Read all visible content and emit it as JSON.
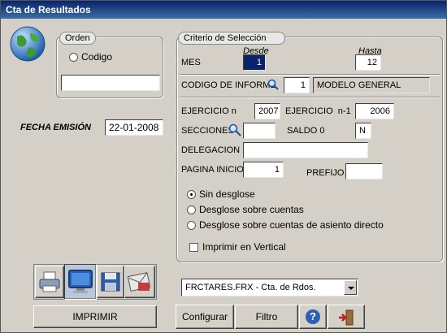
{
  "window": {
    "title": "Cta de Resultados"
  },
  "orden": {
    "legend": "Orden",
    "radio_label": "Codigo",
    "search_value": ""
  },
  "fecha_emision": {
    "label": "FECHA EMISIÓN",
    "value": "22-01-2008"
  },
  "criterio": {
    "legend": "Criterio de Selección",
    "desde_label": "Desde",
    "hasta_label": "Hasta",
    "mes_label": "MES",
    "mes_desde": "1",
    "mes_hasta": "12",
    "codigo_informe_label": "CODIGO DE INFORME",
    "codigo_informe_value": "1",
    "codigo_informe_desc": "MODELO GENERAL",
    "ejercicio_n_label": "EJERCICIO n",
    "ejercicio_n_value": "2007",
    "ejercicio_n1_label": "EJERCICIO  n-1",
    "ejercicio_n1_value": "2006",
    "secciones_label": "SECCIONES",
    "secciones_value": "",
    "saldo0_label": "SALDO 0",
    "saldo0_value": "N",
    "delegacion_label": "DELEGACION",
    "delegacion_value": "",
    "pagina_inicio_label": "PAGINA INICIO",
    "pagina_inicio_value": "1",
    "prefijo_label": "PREFIJO",
    "prefijo_value": "",
    "options": [
      {
        "label": "Sin desglose",
        "selected": true
      },
      {
        "label": "Desglose sobre cuentas",
        "selected": false
      },
      {
        "label": "Desglose sobre cuentas de asiento directo",
        "selected": false
      }
    ],
    "imprimir_vertical_label": "Imprimir en Vertical",
    "imprimir_vertical_checked": false
  },
  "output_icons": [
    "printer-icon",
    "monitor-icon",
    "floppy-disk-icon",
    "mail-icon"
  ],
  "report_select": {
    "value": "FRCTARES.FRX - Cta. de Rdos."
  },
  "buttons": {
    "imprimir": "IMPRIMIR",
    "configurar": "Configurar",
    "filtro": "Filtro",
    "help_glyph": "?"
  }
}
